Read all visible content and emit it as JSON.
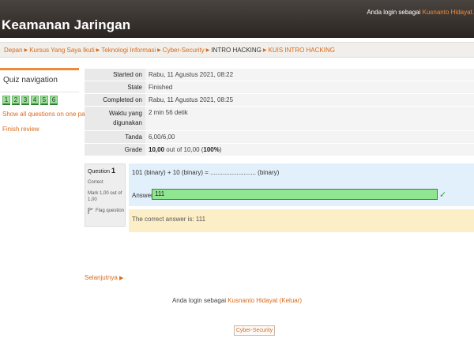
{
  "header": {
    "site_title": "Keamanan Jaringan",
    "login_prefix": "Anda login sebagai ",
    "login_user": "Kusnanto Hidayat."
  },
  "breadcrumb": [
    "Depan",
    "Kursus Yang Saya Ikuti",
    "Teknologi Informasi",
    "Cyber-Security",
    "INTRO HACKING",
    "KUIS INTRO HACKING"
  ],
  "quiz_nav": {
    "title": "Quiz navigation",
    "questions": [
      "1",
      "2",
      "3",
      "4",
      "5",
      "6"
    ],
    "show_all": "Show all questions on one page",
    "finish_review": "Finish review"
  },
  "summary": [
    {
      "label": "Started on",
      "value": "Rabu, 11 Agustus 2021, 08:22"
    },
    {
      "label": "State",
      "value": "Finished"
    },
    {
      "label": "Completed on",
      "value": "Rabu, 11 Agustus 2021, 08:25"
    },
    {
      "label": "Waktu yang digunakan",
      "value": "2 min 56 detik"
    },
    {
      "label": "Tanda",
      "value": "6,00/6,00"
    },
    {
      "label": "Grade",
      "value_bold": "10,00",
      "value_mid": " out of 10,00 (",
      "value_pct": "100%",
      "value_end": ")"
    }
  ],
  "question": {
    "label": "Question ",
    "number": "1",
    "status": "Correct",
    "mark": "Mark 1,00 out of 1,00",
    "flag": "Flag question",
    "text": "101 (binary) + 10 (binary) = .......................... (binary)",
    "answer_label": "Answer:",
    "answer_value": "111",
    "feedback": "The correct answer is: 111"
  },
  "next_label": "Selanjutnya",
  "footer": {
    "login_prefix": "Anda login sebagai ",
    "login_user": "Kusnanto Hidayat",
    "logout": "(Keluar)",
    "course_button": "Cyber-Security"
  },
  "colors": {
    "accent": "#d86a1c",
    "header_bg": "#2b2522",
    "correct_answer_bg": "#90e590",
    "question_bg": "#e2f0fb",
    "feedback_bg": "#fcefc7"
  }
}
